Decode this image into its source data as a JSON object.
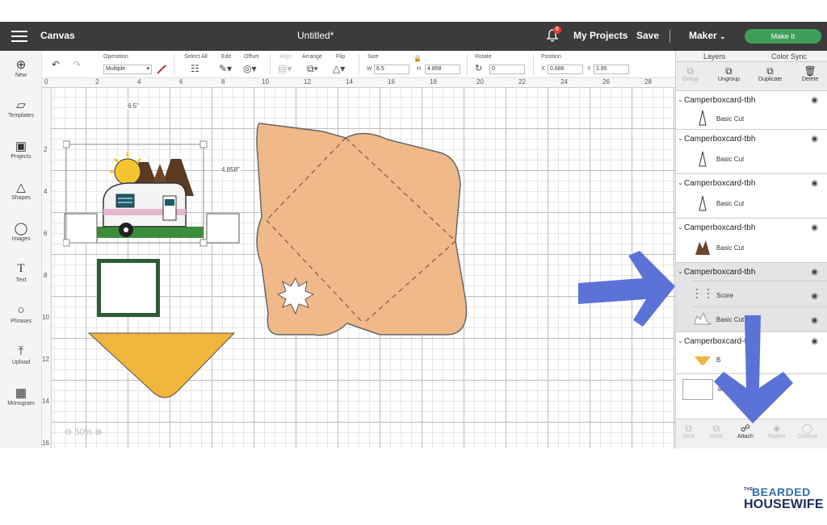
{
  "topbar": {
    "title": "Canvas",
    "project": "Untitled*",
    "notifications": "6",
    "my_projects": "My Projects",
    "save": "Save",
    "maker": "Maker",
    "make_it": "Make It"
  },
  "toolbar": {
    "operation_label": "Operation",
    "operation_value": "Multiple",
    "select_all": "Select All",
    "edit": "Edit",
    "offset": "Offset",
    "align": "Align",
    "arrange": "Arrange",
    "flip": "Flip",
    "size": "Size",
    "w_label": "W",
    "w_value": "6.5",
    "h_label": "H",
    "h_value": "4.858",
    "rotate": "Rotate",
    "rotate_value": "0",
    "position": "Position",
    "x_label": "X",
    "x_value": "0.686",
    "y_label": "Y",
    "y_value": "1.85"
  },
  "leftbar": [
    "New",
    "Templates",
    "Projects",
    "Shapes",
    "Images",
    "Text",
    "Phrases",
    "Upload",
    "Monogram"
  ],
  "ruler": {
    "h": [
      "0",
      "2",
      "4",
      "6",
      "8",
      "10",
      "12",
      "14",
      "16",
      "18",
      "20",
      "22",
      "24",
      "26",
      "28"
    ],
    "v": [
      "2",
      "4",
      "6",
      "8",
      "10",
      "12",
      "14",
      "16"
    ]
  },
  "canvas": {
    "width_dim": "6.5\"",
    "height_dim": "4.858\"",
    "zoom": "50%"
  },
  "panel": {
    "tab_layers": "Layers",
    "tab_colorsync": "Color Sync",
    "actions": [
      "Group",
      "Ungroup",
      "Duplicate",
      "Delete"
    ],
    "groups": [
      {
        "name": "Camperboxcard-tbh",
        "rows": [
          "Basic Cut"
        ]
      },
      {
        "name": "Camperboxcard-tbh",
        "rows": [
          "Basic Cut"
        ]
      },
      {
        "name": "Camperboxcard-tbh",
        "rows": [
          "Basic Cut"
        ]
      },
      {
        "name": "Camperboxcard-tbh",
        "rows": [
          "Basic Cut"
        ]
      },
      {
        "name": "Camperboxcard-tbh",
        "rows": [
          "Score",
          "Basic Cut"
        ]
      },
      {
        "name": "Camperboxcard-tbh",
        "rows": [
          "B"
        ]
      }
    ],
    "blank_canvas": "Blank Canv",
    "bottom": [
      "Slice",
      "Weld",
      "Attach",
      "Flatten",
      "Contour"
    ]
  },
  "colors": {
    "envelope": "#f0b98a",
    "triangle": "#f1b43c",
    "frame": "#2f5b3a",
    "arrow": "#5b72d6",
    "make_it": "#3f9d5a"
  },
  "logo": {
    "small": "THE",
    "line1": "BEARDED",
    "line2": "HOUSEWIFE"
  }
}
